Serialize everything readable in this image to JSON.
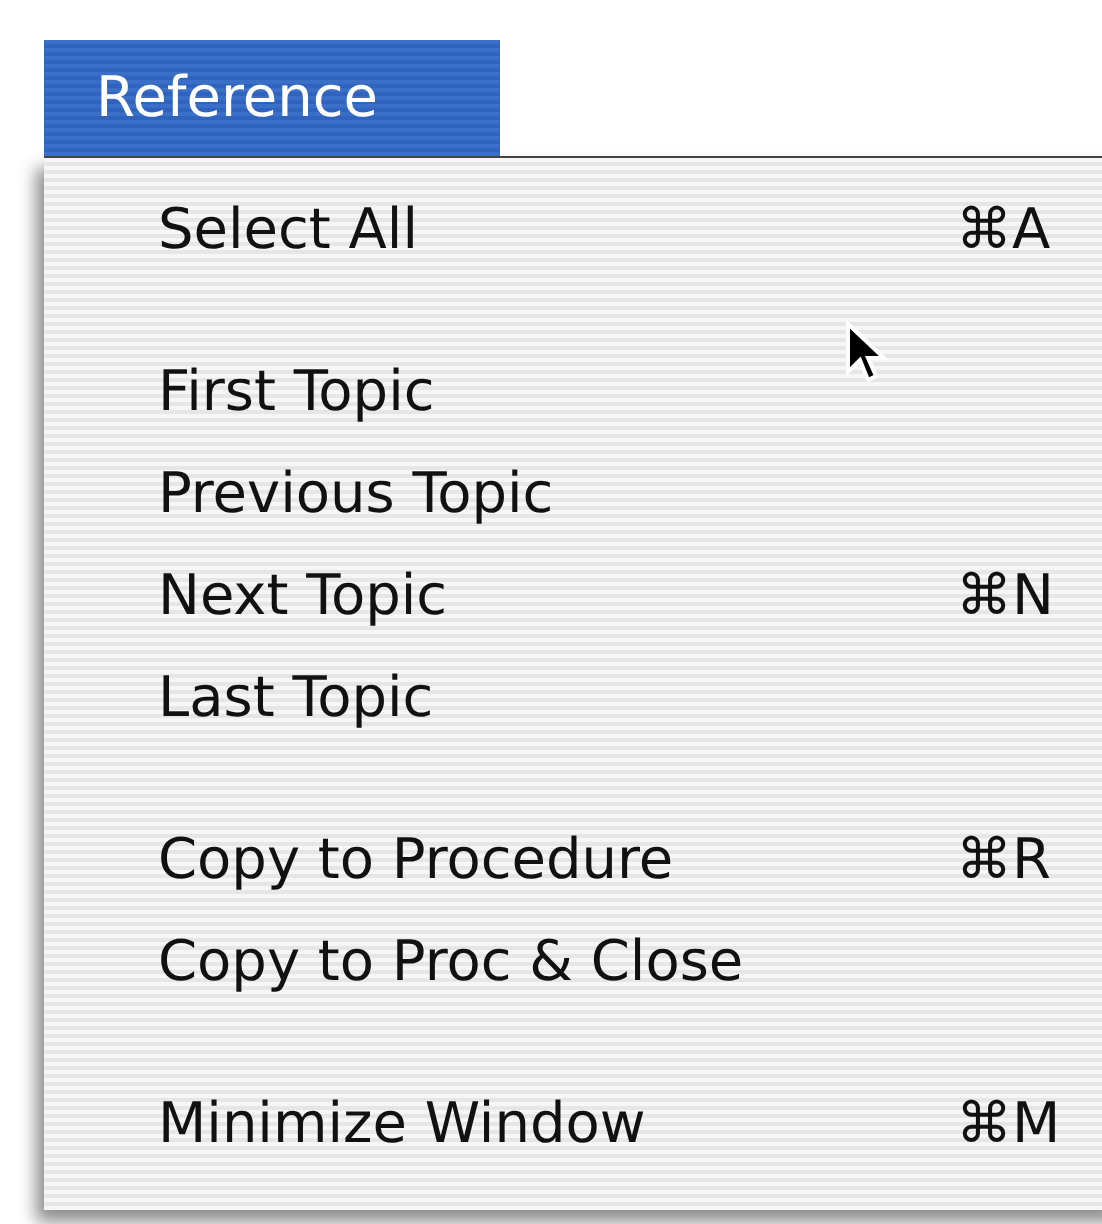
{
  "menu": {
    "title": "Reference",
    "selected": true,
    "groups": [
      [
        {
          "label": "Select All",
          "shortcut": "⌘A"
        }
      ],
      [
        {
          "label": "First Topic"
        },
        {
          "label": "Previous Topic"
        },
        {
          "label": "Next Topic",
          "shortcut": "⌘N"
        },
        {
          "label": "Last Topic"
        }
      ],
      [
        {
          "label": "Copy to Procedure",
          "shortcut": "⌘R"
        },
        {
          "label": "Copy to Proc & Close"
        }
      ],
      [
        {
          "label": "Minimize Window",
          "shortcut": "⌘M"
        }
      ]
    ]
  }
}
